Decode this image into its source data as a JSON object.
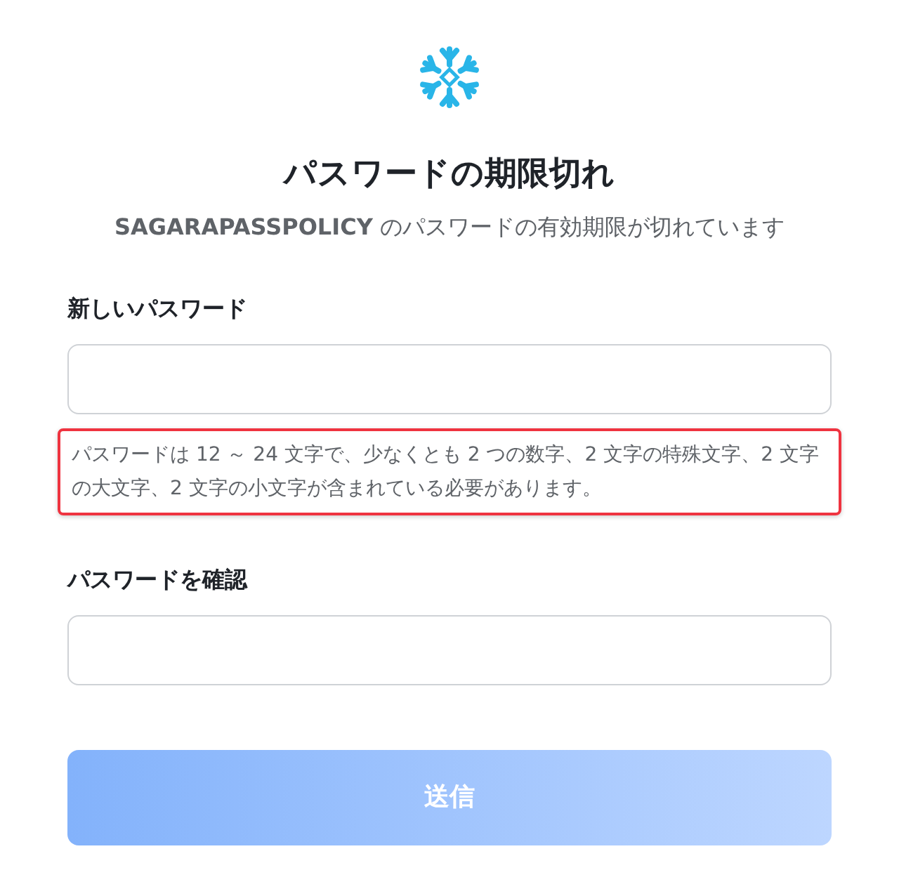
{
  "title": "パスワードの期限切れ",
  "subtitle": "**SAGARAPASSPOLICY** のパスワードの有効期限が切れています",
  "fields": [
    {
      "label": "新しいパスワード",
      "hint": "パスワードは 12 ～ 24 文字で、少なくとも 2 つの数字、2 文字の特殊文字、2 文字の大文字、2 文字の小文字が含まれている必要があります。"
    },
    {
      "label": "パスワードを確認"
    }
  ],
  "submit": {
    "label": "送信",
    "disabled": true
  }
}
